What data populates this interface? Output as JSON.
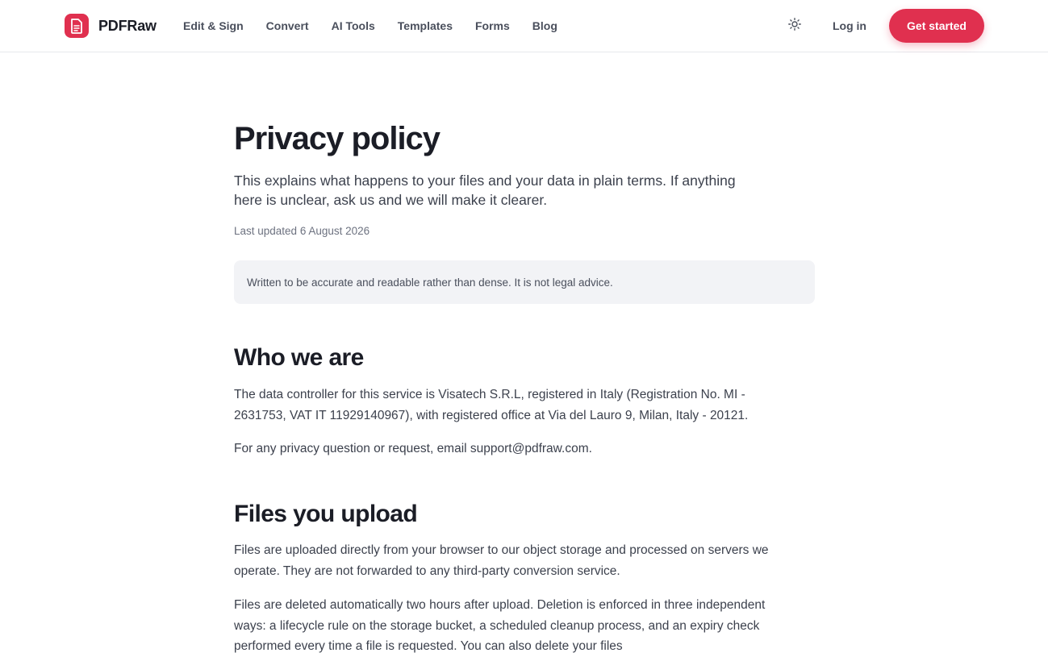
{
  "colors": {
    "brand": "#e0304f",
    "text": "#1b1d26",
    "muted": "#6d7280",
    "notice_bg": "#f2f3f6"
  },
  "header": {
    "brand_name": "PDFRaw",
    "logo_icon": "document-icon",
    "nav": [
      "Edit & Sign",
      "Convert",
      "AI Tools",
      "Templates",
      "Forms",
      "Blog"
    ],
    "theme_icon": "sun-icon",
    "login_label": "Log in",
    "cta_label": "Get started"
  },
  "page": {
    "title": "Privacy policy",
    "lead": "This explains what happens to your files and your data in plain terms. If anything here is unclear, ask us and we will make it clearer.",
    "updated": "Last updated 6 August 2026",
    "notice": "Written to be accurate and readable rather than dense. It is not legal advice."
  },
  "sections": [
    {
      "title": "Who we are",
      "paragraphs": [
        "The data controller for this service is Visatech S.R.L, registered in Italy (Registration No. MI - 2631753, VAT IT 11929140967), with registered office at Via del Lauro 9, Milan, Italy - 20121.",
        "For any privacy question or request, email support@pdfraw.com."
      ]
    },
    {
      "title": "Files you upload",
      "paragraphs": [
        "Files are uploaded directly from your browser to our object storage and processed on servers we operate. They are not forwarded to any third-party conversion service.",
        "Files are deleted automatically two hours after upload. Deletion is enforced in three independent ways: a lifecycle rule on the storage bucket, a scheduled cleanup process, and an expiry check performed every time a file is requested. You can also delete your files"
      ]
    }
  ]
}
